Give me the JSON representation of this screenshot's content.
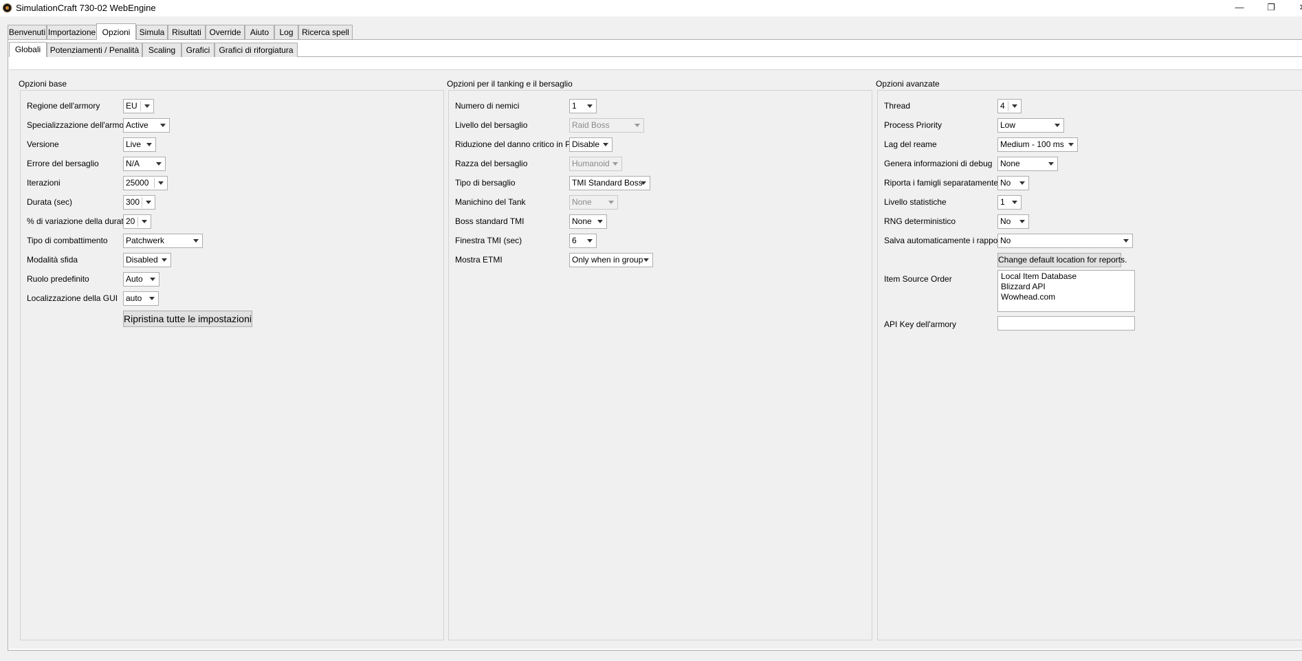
{
  "window": {
    "title": "SimulationCraft 730-02 WebEngine",
    "minimize_icon": "minimize-icon",
    "maximize_icon": "restore-icon",
    "close_icon": "close-icon",
    "minimize_glyph": "—",
    "maximize_glyph": "❐",
    "close_glyph": "✕"
  },
  "main_tabs": [
    {
      "label": "Benvenuti"
    },
    {
      "label": "Importazione"
    },
    {
      "label": "Opzioni",
      "active": true
    },
    {
      "label": "Simula"
    },
    {
      "label": "Risultati"
    },
    {
      "label": "Override"
    },
    {
      "label": "Aiuto"
    },
    {
      "label": "Log"
    },
    {
      "label": "Ricerca spell"
    }
  ],
  "sub_tabs": [
    {
      "label": "Globali",
      "active": true
    },
    {
      "label": "Potenziamenti / Penalità"
    },
    {
      "label": "Scaling"
    },
    {
      "label": "Grafici"
    },
    {
      "label": "Grafici di riforgiatura"
    }
  ],
  "basic": {
    "title": "Opzioni base",
    "rows": [
      {
        "label": "Regione dell'armory",
        "value": "EU"
      },
      {
        "label": "Specializzazione dell'armory",
        "value": "Active"
      },
      {
        "label": "Versione",
        "value": "Live"
      },
      {
        "label": "Errore del bersaglio",
        "value": "N/A"
      },
      {
        "label": "Iterazioni",
        "value": "25000"
      },
      {
        "label": "Durata (sec)",
        "value": "300"
      },
      {
        "label": "% di variazione della durata",
        "value": "20"
      },
      {
        "label": "Tipo di combattimento",
        "value": "Patchwerk"
      },
      {
        "label": "Modalità sfida",
        "value": "Disabled"
      },
      {
        "label": "Ruolo predefinito",
        "value": "Auto"
      },
      {
        "label": "Localizzazione della GUI",
        "value": "auto"
      }
    ],
    "reset_button": "Ripristina tutte le impostazioni"
  },
  "tanking": {
    "title": "Opzioni per il tanking e il bersaglio",
    "rows": [
      {
        "label": "Numero di nemici",
        "value": "1",
        "enabled": true
      },
      {
        "label": "Livello del bersaglio",
        "value": "Raid Boss",
        "enabled": false
      },
      {
        "label": "Riduzione del danno critico in PVP",
        "value": "Disable",
        "enabled": true
      },
      {
        "label": "Razza del bersaglio",
        "value": "Humanoid",
        "enabled": false
      },
      {
        "label": "Tipo di bersaglio",
        "value": "TMI Standard Boss",
        "enabled": true
      },
      {
        "label": "Manichino del Tank",
        "value": "None",
        "enabled": false
      },
      {
        "label": "Boss standard TMI",
        "value": "None",
        "enabled": true
      },
      {
        "label": "Finestra TMI (sec)",
        "value": "6",
        "enabled": true
      },
      {
        "label": "Mostra ETMI",
        "value": "Only when in group",
        "enabled": true
      }
    ]
  },
  "advanced": {
    "title": "Opzioni avanzate",
    "rows": [
      {
        "label": "Thread",
        "value": "4"
      },
      {
        "label": "Process Priority",
        "value": "Low"
      },
      {
        "label": "Lag del reame",
        "value": "Medium - 100 ms"
      },
      {
        "label": "Genera informazioni di debug",
        "value": "None"
      },
      {
        "label": "Riporta i famigli separatamente",
        "value": "No"
      },
      {
        "label": "Livello statistiche",
        "value": "1"
      },
      {
        "label": "RNG deterministico",
        "value": "No"
      },
      {
        "label": "Salva automaticamente i rapporti",
        "value": "No"
      }
    ],
    "change_location_button": "Change default location for reports.",
    "item_source_label": "Item Source Order",
    "item_sources": [
      "Local Item Database",
      "Blizzard API",
      "Wowhead.com"
    ],
    "api_key_label": "API Key dell'armory",
    "api_key_value": ""
  }
}
